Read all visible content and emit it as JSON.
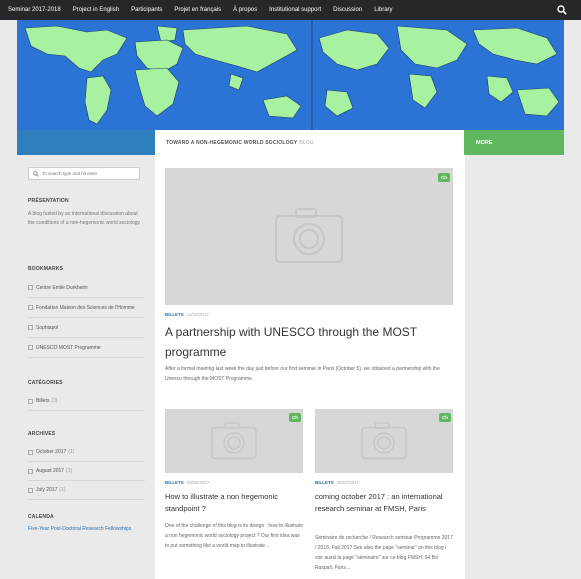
{
  "nav": {
    "items": [
      "Seminar 2017-2018",
      "Project in English",
      "Participants",
      "Projet en français",
      "À propos",
      "Institutional support",
      "Discussion",
      "Library"
    ],
    "search_icon": "search-icon"
  },
  "band": {
    "blog_name": "TOWARD A NON-HEGEMONIC WORLD SOCIOLOGY",
    "blog_suffix": "BLOG",
    "more": "MORE"
  },
  "sidebar": {
    "search_placeholder": "To search type and hit enter",
    "presentation_title": "PRÉSENTATION",
    "presentation_text": "A blog fueled by an international discussion about the conditions of a non-hegemonic world sociology",
    "bookmarks_title": "BOOKMARKS",
    "bookmarks": [
      "Centre Emile Durkheim",
      "Fondation Maison des Sciences de l'Homme",
      "Sophiapol",
      "UNESCO MOST Programme"
    ],
    "categories_title": "CATÉGORIES",
    "categories": [
      {
        "name": "Billets",
        "count": "(3)"
      }
    ],
    "archives_title": "ARCHIVES",
    "archives": [
      {
        "name": "October 2017",
        "count": "(1)"
      },
      {
        "name": "August 2017",
        "count": "(1)"
      },
      {
        "name": "July 2017",
        "count": "(1)"
      }
    ],
    "calendar_title": "CALENDA",
    "calendar_link": "Five-Year Post-Doctoral Research Fellowships"
  },
  "featured": {
    "badge": "Ch",
    "category": "BILLETS",
    "date": "11/10/2017",
    "title": "A partnership with UNESCO through the MOST programme",
    "excerpt": "After a formal meeting last week the day just before our first seminar in Paris (October 5), we obtained a partnership with the Unesco through the MOST Programme."
  },
  "cards": [
    {
      "badge": "Ch",
      "category": "BILLETS",
      "date": "28/08/2017",
      "title": "How to illustrate a non hegemonic standpoint ?",
      "excerpt": "One of the challenge of this blog is its design : how to illustrate a non hegemonic world sociology project ? Our first idea was to put something like a world map to illustrate…"
    },
    {
      "badge": "Ch",
      "category": "BILLETS",
      "date": "25/07/2017",
      "title": "coming october 2017 : an international research seminar at FMSH, Paris",
      "excerpt": "Séminaire de recherche / Research seminar Programme 2017 / 2018, Fall 2017 See also the page \"seminar\" on this blog / voir aussi la page \"séminaire\" sur ce blog FMSH, 54 Bd Raspail, Paris…"
    }
  ],
  "colors": {
    "nav_bg": "#26272b",
    "accent_blue": "#2f7fbf",
    "accent_green": "#5fb85f",
    "map_ocean": "#2b74d6",
    "map_land": "#a6f2a0"
  }
}
